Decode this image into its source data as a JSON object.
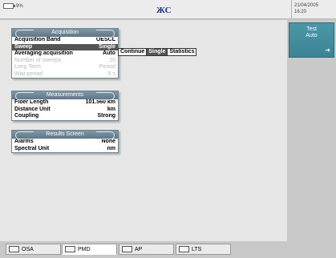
{
  "status": {
    "battery": "9%",
    "date": "21/04/2005",
    "time": "16:20"
  },
  "logo": {
    "text": "EXFO"
  },
  "test_button": {
    "line1": "Test",
    "line2": "Auto"
  },
  "acquisition": {
    "title": "Acquisition",
    "rows": [
      {
        "label": "Acquisition Band",
        "value": "OESCL"
      },
      {
        "label": "Sweep",
        "value": "Single"
      },
      {
        "label": "Averaging acquisition",
        "value": "Auto"
      },
      {
        "label": "Number of sweeps",
        "value": "10"
      },
      {
        "label": "Long Term",
        "value": "Period"
      },
      {
        "label": "Wait period",
        "value": "5 s"
      }
    ]
  },
  "sweep_popup": {
    "options": [
      "Continue",
      "Single",
      "Statistics"
    ],
    "selected": "Single"
  },
  "measurements": {
    "title": "Measurements",
    "rows": [
      {
        "label": "Fiber Length",
        "value": "101.560 km"
      },
      {
        "label": "Distance Unit",
        "value": "km"
      },
      {
        "label": "Coupling",
        "value": "Strong"
      }
    ]
  },
  "results_screen": {
    "title": "Results Screen",
    "rows": [
      {
        "label": "Alarms",
        "value": "None"
      },
      {
        "label": "Spectral Unit",
        "value": "nm"
      }
    ]
  },
  "tabs": [
    {
      "label": "OSA",
      "icon": "osa-icon"
    },
    {
      "label": "PMD",
      "icon": "pmd-icon"
    },
    {
      "label": "AP",
      "icon": "ap-icon"
    },
    {
      "label": "LTS",
      "icon": "lts-icon"
    }
  ]
}
